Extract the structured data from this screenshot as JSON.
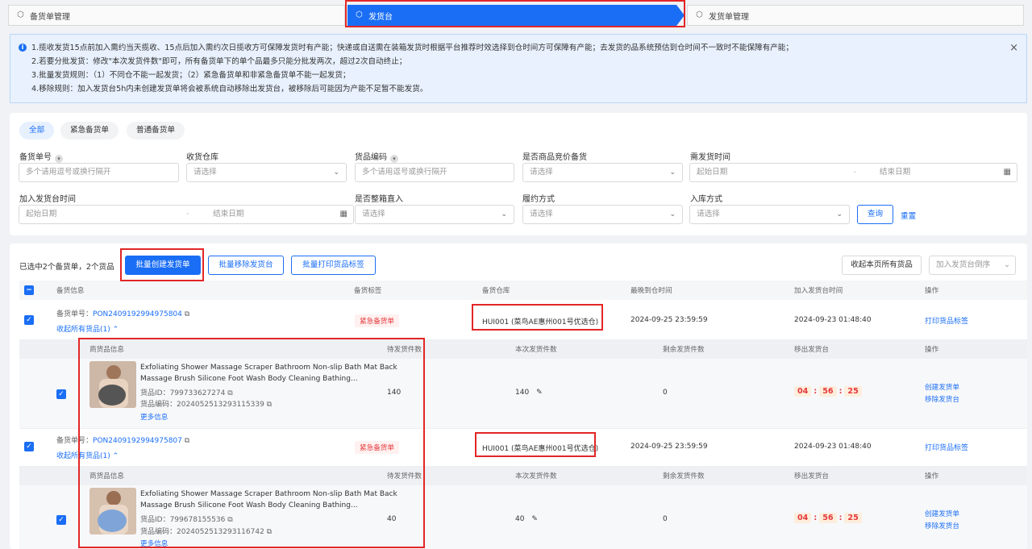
{
  "steps": [
    {
      "label": "备货单管理"
    },
    {
      "label": "发货台"
    },
    {
      "label": "发货单管理"
    }
  ],
  "notice": {
    "lines": [
      "1.揽收发货15点前加入需约当天揽收、15点后加入需约次日揽收方可保障发货时有产能；快递或自送需在装箱发货时根据平台推荐时效选择到仓时间方可保障有产能；去发货的品系统预估到仓时间不一致时不能保障有产能；",
      "2.若要分批发货：修改\"本次发货件数\"即可，所有备货单下的单个品最多只能分批发两次，超过2次自动终止；",
      "3.批量发货规则：（1）不同仓不能一起发货；（2）紧急备货单和非紧急备货单不能一起发货；",
      "4.移除规则：加入发货台5h内未创建发货单将会被系统自动移除出发货台，被移除后可能因为产能不足暂不能发货。"
    ],
    "close": "×"
  },
  "filters": {
    "chips": [
      "全部",
      "紧急备货单",
      "普通备货单"
    ],
    "order_no": {
      "label": "备货单号",
      "placeholder": "多个请用逗号或换行隔开"
    },
    "warehouse": {
      "label": "收货仓库",
      "placeholder": "请选择"
    },
    "sku_code": {
      "label": "货品编码",
      "placeholder": "多个请用逗号或换行隔开"
    },
    "price_compare": {
      "label": "是否商品竞价备货",
      "placeholder": "请选择"
    },
    "need_time": {
      "label": "需发货时间",
      "start": "起始日期",
      "sep": "-",
      "end": "结束日期"
    },
    "join_time": {
      "label": "加入发货台时间",
      "start": "起始日期",
      "sep": "-",
      "end": "结束日期"
    },
    "box_direct": {
      "label": "是否整箱直入",
      "placeholder": "请选择"
    },
    "fulfill": {
      "label": "履约方式",
      "placeholder": "请选择"
    },
    "inbound": {
      "label": "入库方式",
      "placeholder": "请选择"
    },
    "search": "查询",
    "reset": "重置"
  },
  "toolbar": {
    "selected": "已选中2个备货单，2个货品",
    "create": "批量创建发货单",
    "remove": "批量移除发货台",
    "print": "批量打印货品标签",
    "collapse": "收起本页所有货品",
    "sort": "加入发货台倒序"
  },
  "table": {
    "headers": [
      "备货信息",
      "备货标签",
      "备货仓库",
      "最晚到仓时间",
      "加入发货台时间",
      "操作"
    ],
    "sub_headers": [
      "商货品信息",
      "待发货件数",
      "本次发货件数",
      "剩余发货件数",
      "移出发货台",
      "操作"
    ],
    "orders": [
      {
        "order_label": "备货单号：",
        "order_no": "PON2409192994975804",
        "toggle": "收起所有货品(1)",
        "tag": "紧急备货单",
        "warehouse": "HUI001 (菜鸟AE惠州001号优选仓)",
        "latest": "2024-09-25 23:59:59",
        "joined": "2024-09-23 01:48:40",
        "action": "打印货品标签",
        "item": {
          "title1": "Exfoliating Shower Massage Scraper Bathroom Non-slip Bath Mat Back",
          "title2": "Massage Brush Silicone Foot Wash Body Cleaning Bathing...",
          "goods_id": "货品ID：799733627274",
          "goods_code": "货品编码：2024052513293115339",
          "more": "更多信息",
          "pending": "140",
          "this_time": "140",
          "remaining": "0",
          "timer": [
            "04",
            "56",
            "25"
          ],
          "create": "创建发货单",
          "remove": "移除发货台"
        }
      },
      {
        "order_label": "备货单号：",
        "order_no": "PON2409192994975807",
        "toggle": "收起所有货品(1)",
        "tag": "紧急备货单",
        "warehouse": "HUI001 (菜鸟AE惠州001号优选仓)",
        "latest": "2024-09-25 23:59:59",
        "joined": "2024-09-23 01:48:40",
        "action": "打印货品标签",
        "item": {
          "title1": "Exfoliating Shower Massage Scraper Bathroom Non-slip Bath Mat Back",
          "title2": "Massage Brush Silicone Foot Wash Body Cleaning Bathing...",
          "goods_id": "货品ID：799678155536",
          "goods_code": "货品编码：2024052513293116742",
          "more": "更多信息",
          "pending": "40",
          "this_time": "40",
          "remaining": "0",
          "timer": [
            "04",
            "56",
            "25"
          ],
          "create": "创建发货单",
          "remove": "移除发货台"
        }
      }
    ]
  },
  "colors": {
    "primary": "#1a6ef5",
    "danger": "#e5383b",
    "annotation": "#e32626"
  }
}
